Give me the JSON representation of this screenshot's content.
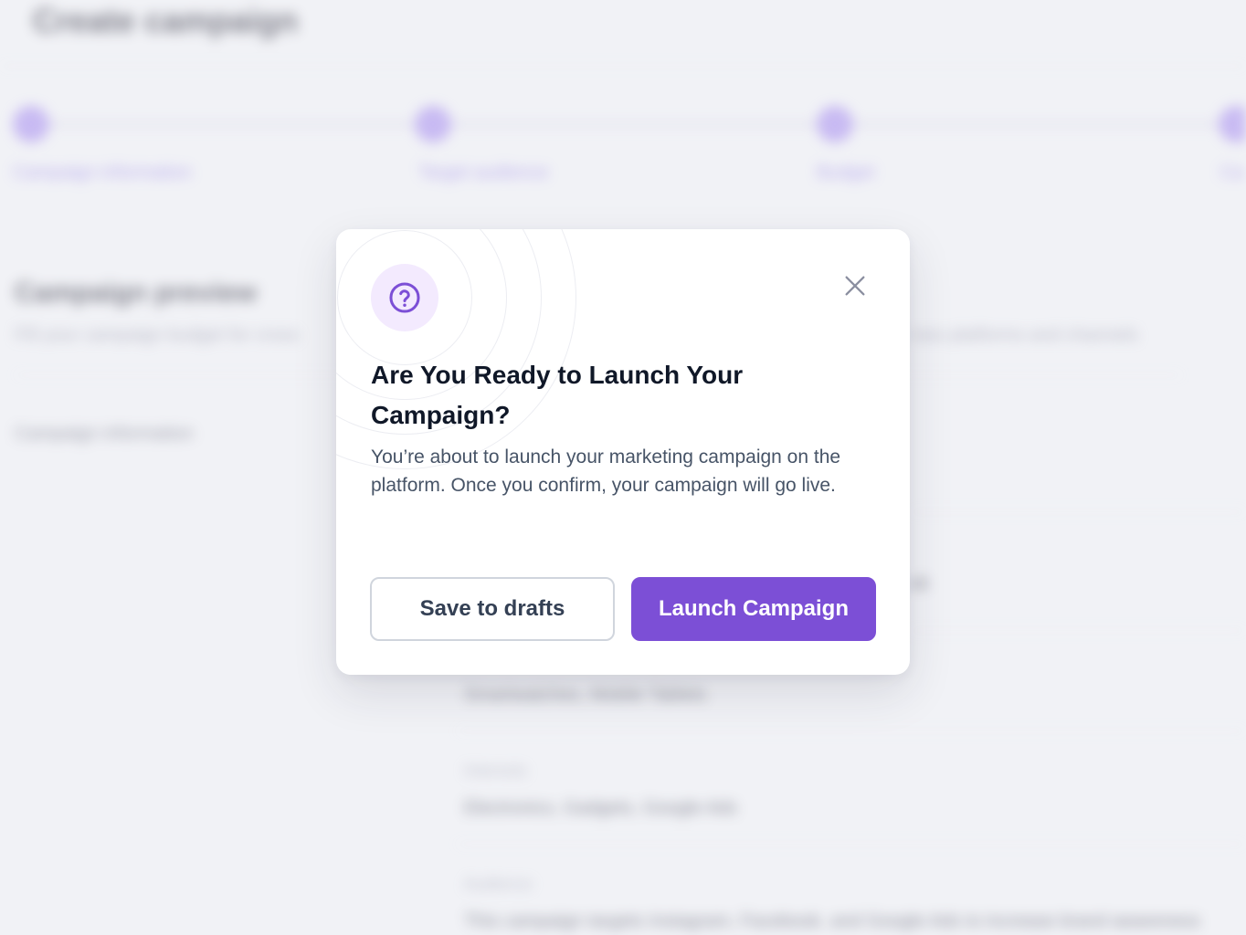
{
  "background": {
    "page_title": "Create campaign",
    "steps": [
      {
        "label": "Campaign information"
      },
      {
        "label": "Target audience"
      },
      {
        "label": "Budget"
      },
      {
        "label": "Ca"
      }
    ],
    "section_title": "Campaign preview",
    "section_subtitle": "Fill your campaign budget for cross",
    "section_subtitle_right": "ross platforms and channels",
    "sidenav_item": "Campaign information",
    "fields": [
      {
        "value": "Smartwatches, Mobile Tablets"
      },
      {
        "label": "Interests",
        "value": "Electronics, Gadgets, Google Ads"
      },
      {
        "label": "Audience",
        "value": "This campaign targets Instagram, Facebook, and Google Ads to increase brand awareness"
      }
    ],
    "field_right": "ak"
  },
  "modal": {
    "icon": "help-circle-icon",
    "title": "Are You Ready to Launch Your Campaign?",
    "description": "You’re about to launch your marketing campaign on the platform. Once you confirm, your campaign will go live.",
    "secondary_button": "Save to drafts",
    "primary_button": "Launch Campaign",
    "close_icon": "close-icon"
  },
  "colors": {
    "accent": "#7c4fd6",
    "icon_bg": "#f3eafe",
    "title": "#101828",
    "text": "#475467"
  }
}
